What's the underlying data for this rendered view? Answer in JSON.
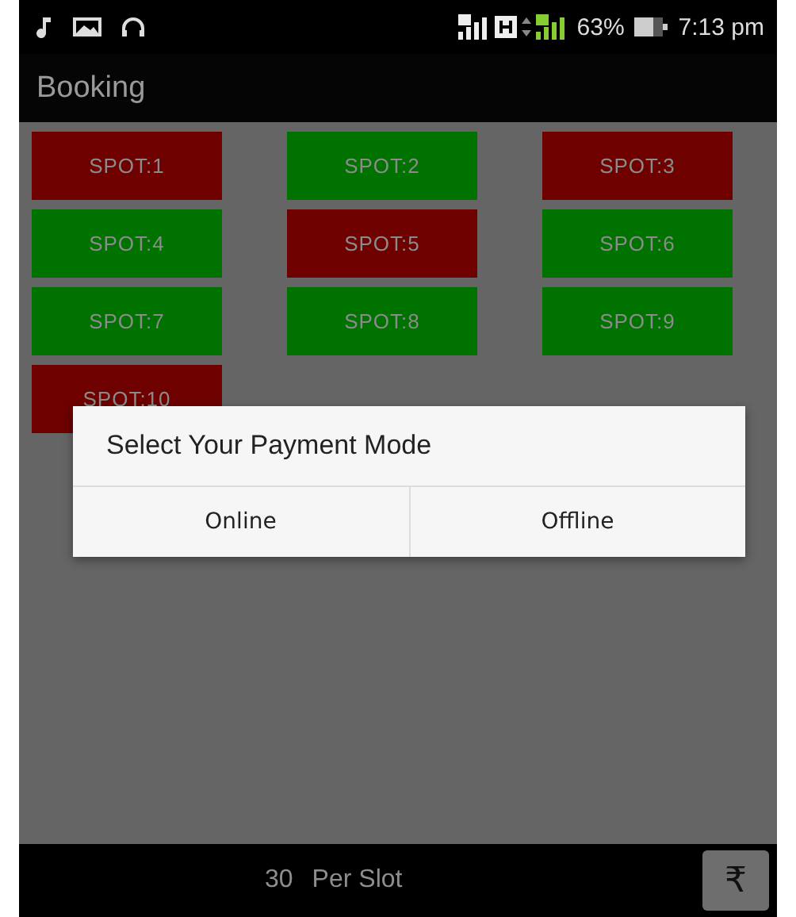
{
  "status_bar": {
    "battery_percent": "63%",
    "time": "7:13 pm"
  },
  "app_bar": {
    "title": "Booking"
  },
  "spots": [
    {
      "label": "SPOT:1",
      "color": "#6e0000"
    },
    {
      "label": "SPOT:2",
      "color": "#007200"
    },
    {
      "label": "SPOT:3",
      "color": "#6e0000"
    },
    {
      "label": "SPOT:4",
      "color": "#007200"
    },
    {
      "label": "SPOT:5",
      "color": "#6e0000"
    },
    {
      "label": "SPOT:6",
      "color": "#007200"
    },
    {
      "label": "SPOT:7",
      "color": "#007200"
    },
    {
      "label": "SPOT:8",
      "color": "#007200"
    },
    {
      "label": "SPOT:9",
      "color": "#007200"
    },
    {
      "label": "SPOT:10",
      "color": "#6e0000"
    }
  ],
  "dialog": {
    "title": "Select Your Payment Mode",
    "buttons": [
      "Online",
      "Offline"
    ]
  },
  "bottom_bar": {
    "price": "30",
    "unit": "Per Slot",
    "button": "₹"
  }
}
